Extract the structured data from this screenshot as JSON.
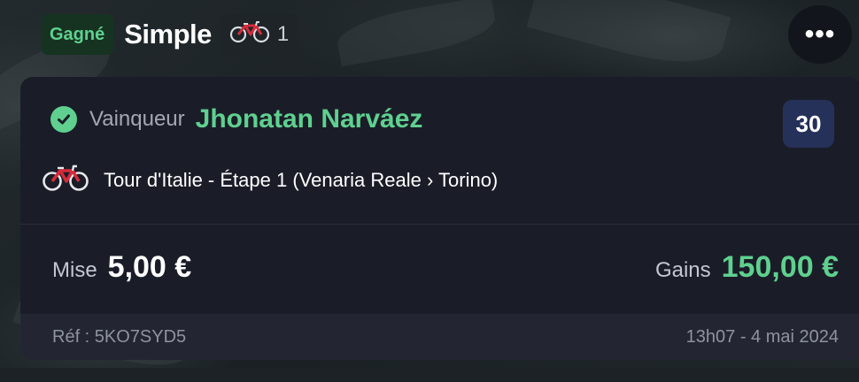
{
  "header": {
    "status_badge": "Gagné",
    "bet_type": "Simple",
    "selections_count": "1",
    "more_label": "•••"
  },
  "selection": {
    "label": "Vainqueur",
    "name": "Jhonatan Narváez",
    "odds": "30",
    "event": "Tour d'Italie - Étape 1 (Venaria Reale › Torino)",
    "sport_icon": "bicycle-icon"
  },
  "stake": {
    "label": "Mise",
    "value": "5,00 €"
  },
  "gains": {
    "label": "Gains",
    "value": "150,00 €"
  },
  "footer": {
    "ref": "Réf : 5KO7SYD5",
    "date": "13h07 - 4 mai 2024"
  },
  "colors": {
    "accent_green": "#5fd08f",
    "card_bg": "#1a1d28",
    "odds_bg": "#26315a",
    "bike_red": "#d62b3a"
  }
}
